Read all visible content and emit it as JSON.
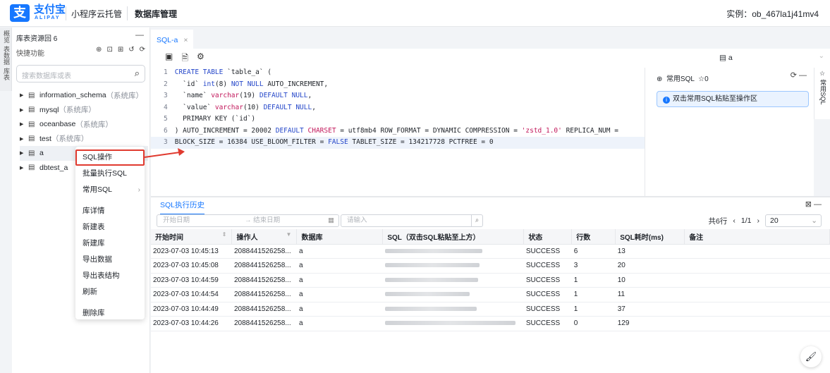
{
  "header": {
    "logo_cn": "支付宝",
    "logo_en": "ALIPAY",
    "nav1": "小程序云托管",
    "nav2": "数据库管理",
    "instance": "实例：ob_467la1j41mv4"
  },
  "leftstrip": [
    "概览",
    "表数据",
    "库表"
  ],
  "sidebar": {
    "title": "库表资源回 6",
    "quick": "快捷功能",
    "search_placeholder": "搜索数据库或表",
    "tree": [
      {
        "name": "information_schema",
        "sys": "（系统库）"
      },
      {
        "name": "mysql",
        "sys": "（系统库）"
      },
      {
        "name": "oceanbase",
        "sys": "（系统库）"
      },
      {
        "name": "test",
        "sys": "（系统库）"
      },
      {
        "name": "a",
        "sys": ""
      },
      {
        "name": "dbtest_a",
        "sys": ""
      }
    ]
  },
  "context_menu": [
    "SQL操作",
    "批量执行SQL",
    "常用SQL",
    "库详情",
    "新建表",
    "新建库",
    "导出数据",
    "导出表结构",
    "刷新",
    "删除库"
  ],
  "editor": {
    "tab": "SQL-a",
    "db_label": "a",
    "lines": [
      "CREATE TABLE `table_a` (",
      "  `id` int(8) NOT NULL AUTO_INCREMENT,",
      "  `name` varchar(19) DEFAULT NULL,",
      "  `value` varchar(10) DEFAULT NULL,",
      "  PRIMARY KEY (`id`)",
      ") AUTO_INCREMENT = 20002 DEFAULT CHARSET = utf8mb4 ROW_FORMAT = DYNAMIC COMPRESSION = 'zstd_1.0' REPLICA_NUM =",
      "BLOCK_SIZE = 16384 USE_BLOOM_FILTER = FALSE TABLET_SIZE = 134217728 PCTFREE = 0"
    ],
    "line_numbers": [
      "1",
      "2",
      "3",
      "4",
      "5",
      "6",
      "3"
    ]
  },
  "fav": {
    "title": "常用SQL",
    "star": "☆0",
    "tip": "双击常用SQL粘贴至操作区",
    "strip": "常用SQL"
  },
  "history": {
    "tab": "SQL执行历史",
    "start_placeholder": "开始日期",
    "end_placeholder": "→ 结束日期",
    "input_placeholder": "请输入",
    "total": "共6行",
    "page": "1/1",
    "page_size": "20",
    "columns": [
      "开始时间",
      "操作人",
      "数据库",
      "SQL（双击SQL粘贴至上方）",
      "状态",
      "行数",
      "SQL耗时(ms)",
      "备注"
    ],
    "rows": [
      [
        "2023-07-03 10:45:13",
        "2088441526258...",
        "a",
        "SUCCESS",
        "6",
        "13"
      ],
      [
        "2023-07-03 10:45:08",
        "2088441526258...",
        "a",
        "SUCCESS",
        "3",
        "20"
      ],
      [
        "2023-07-03 10:44:59",
        "2088441526258...",
        "a",
        "SUCCESS",
        "1",
        "10"
      ],
      [
        "2023-07-03 10:44:54",
        "2088441526258...",
        "a",
        "SUCCESS",
        "1",
        "11"
      ],
      [
        "2023-07-03 10:44:49",
        "2088441526258...",
        "a",
        "SUCCESS",
        "1",
        "37"
      ],
      [
        "2023-07-03 10:44:26",
        "2088441526258...",
        "a",
        "SUCCESS",
        "0",
        "129"
      ]
    ]
  },
  "colors": {
    "accent": "#1677ff",
    "highlight": "#e03a2f"
  }
}
